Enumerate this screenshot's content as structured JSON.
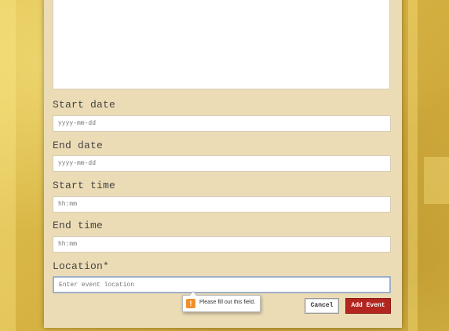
{
  "form": {
    "start_date_label": "Start date",
    "start_date_placeholder": "yyyy-mm-dd",
    "end_date_label": "End date",
    "end_date_placeholder": "yyyy-mm-dd",
    "start_time_label": "Start time",
    "start_time_placeholder": "hh:mm",
    "end_time_label": "End time",
    "end_time_placeholder": "hh:mm",
    "location_label": "Location*",
    "location_placeholder": "Enter event location"
  },
  "validation": {
    "message": "Please fill out this field.",
    "icon": "warning-icon",
    "icon_glyph": "!"
  },
  "actions": {
    "cancel_label": "Cancel",
    "add_label": "Add Event"
  },
  "colors": {
    "background": "#d9b84a",
    "panel": "#ecdcb6",
    "primary_button": "#b3251f",
    "warning": "#f0902b"
  }
}
